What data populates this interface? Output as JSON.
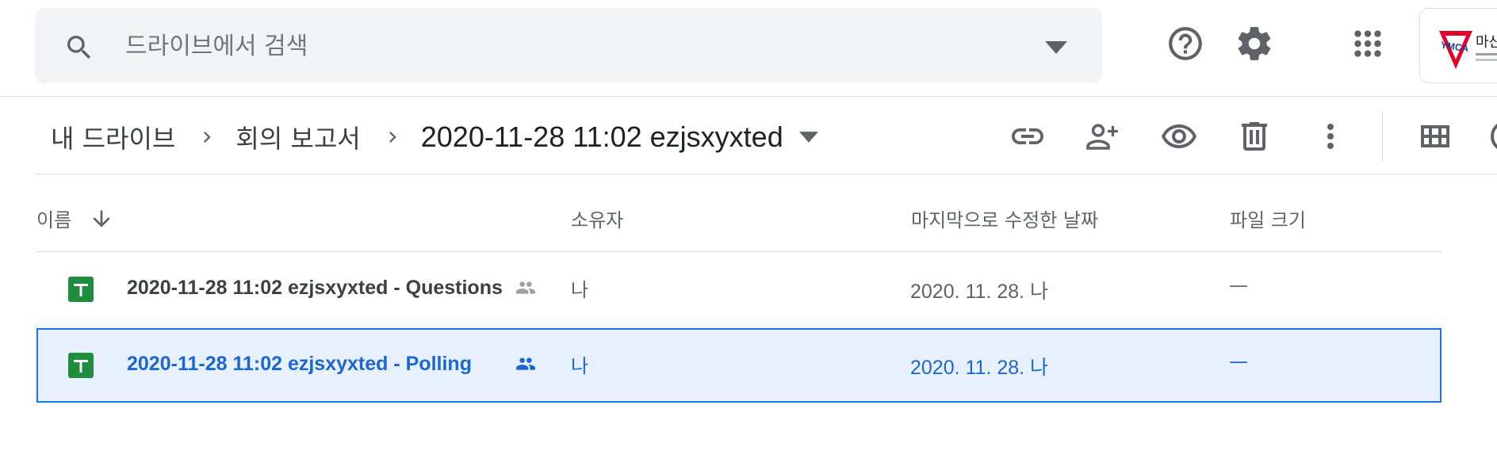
{
  "search": {
    "placeholder": "드라이브에서 검색"
  },
  "header_icons": [
    "search-icon",
    "chevron-down-icon",
    "help-icon",
    "gear-icon",
    "apps-grid-icon"
  ],
  "account": {
    "logo_text": "YMCA",
    "org_text": "마산YMCA"
  },
  "breadcrumb": {
    "items": [
      "내 드라이브",
      "회의 보고서"
    ],
    "current": "2020-11-28 11:02 ezjsxyxted"
  },
  "toolbar_icons": [
    "link-icon",
    "add-person-icon",
    "eye-icon",
    "trash-icon",
    "more-vert-icon",
    "grid-view-icon"
  ],
  "columns": {
    "name": "이름",
    "owner": "소유자",
    "modified": "마지막으로 수정한 날짜",
    "size": "파일 크기"
  },
  "files": [
    {
      "name": "2020-11-28 11:02 ezjsxyxted - Questions",
      "owner": "나",
      "modified": "2020. 11. 28. 나",
      "size": "—",
      "selected": false
    },
    {
      "name": "2020-11-28 11:02 ezjsxyxted - Polling",
      "owner": "나",
      "modified": "2020. 11. 28. 나",
      "size": "—",
      "selected": true
    }
  ],
  "colors": {
    "accent": "#1a73e8",
    "selected_bg": "#e8f0fe",
    "sheets_green": "#1e8e3e",
    "ymca_red": "#e4002b"
  }
}
